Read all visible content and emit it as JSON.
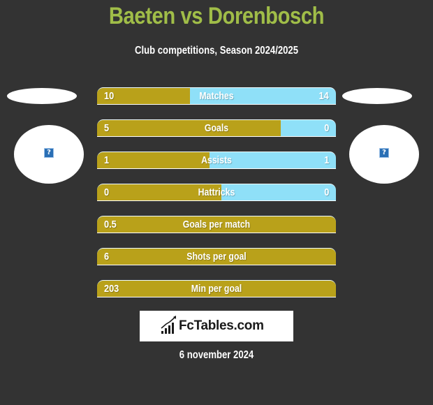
{
  "header": {
    "title": "Baeten vs Dorenbosch",
    "subtitle": "Club competitions, Season 2024/2025"
  },
  "players": {
    "left": {
      "name": "Baeten",
      "avatar_icon": "missing-image-icon"
    },
    "right": {
      "name": "Dorenbosch",
      "avatar_icon": "missing-image-icon"
    }
  },
  "colors": {
    "background": "#333333",
    "title": "#a0bd48",
    "left_bar": "#b9a11a",
    "right_bar": "#8fe0f8",
    "text": "#ffffff"
  },
  "stats": [
    {
      "label": "Matches",
      "left": "10",
      "right": "14",
      "left_fraction": 0.39
    },
    {
      "label": "Goals",
      "left": "5",
      "right": "0",
      "left_fraction": 0.77
    },
    {
      "label": "Assists",
      "left": "1",
      "right": "1",
      "left_fraction": 0.47
    },
    {
      "label": "Hattricks",
      "left": "0",
      "right": "0",
      "left_fraction": 0.52
    },
    {
      "label": "Goals per match",
      "left": "0.5",
      "right": "",
      "left_fraction": 1.0
    },
    {
      "label": "Shots per goal",
      "left": "6",
      "right": "",
      "left_fraction": 1.0
    },
    {
      "label": "Min per goal",
      "left": "203",
      "right": "",
      "left_fraction": 1.0
    }
  ],
  "logo": {
    "text": "FcTables.com",
    "icon": "bar-chart-trend-icon"
  },
  "footer": {
    "date": "6 november 2024"
  }
}
